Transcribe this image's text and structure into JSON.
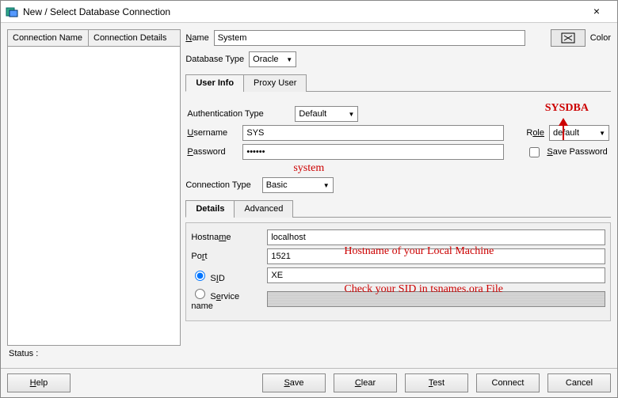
{
  "window": {
    "title": "New / Select Database Connection",
    "close_glyph": "×"
  },
  "left": {
    "col_name": "Connection Name",
    "col_details": "Connection Details",
    "status_label": "Status :"
  },
  "form": {
    "name_label_pre": "N",
    "name_label_post": "ame",
    "name_value": "System",
    "color_label": "Color",
    "dbtype_label": "Database Type",
    "dbtype_value": "Oracle",
    "tab_userinfo": "User Info",
    "tab_proxy": "Proxy User",
    "authtype_label": "Authentication Type",
    "authtype_value": "Default",
    "username_label_pre": "U",
    "username_label_post": "sername",
    "username_value": "SYS",
    "password_label_pre": "P",
    "password_label_post": "assword",
    "password_value": "••••••",
    "role_label_pre": "R",
    "role_label_post": "ole",
    "role_value": "default",
    "savepass_label_pre": "S",
    "savepass_label_post": "ave Password",
    "conntype_label": "Connection Type",
    "conntype_value": "Basic",
    "tab_details": "Details",
    "tab_advanced": "Advanced",
    "hostname_label_pre": "Hostna",
    "hostname_label_u": "m",
    "hostname_label_post": "e",
    "hostname_value": "localhost",
    "port_label_pre": "Po",
    "port_label_u": "r",
    "port_label_post": "t",
    "port_value": "1521",
    "sid_label_pre": "S",
    "sid_label_u": "I",
    "sid_label_post": "D",
    "sid_value": "XE",
    "service_label_pre": "S",
    "service_label_u": "e",
    "service_label_post": "rvice name"
  },
  "annotations": {
    "sysdba": "SYSDBA",
    "system": "system",
    "hostname_hint": "Hostname of your Local Machine",
    "sid_hint": "Check your SID in tsnames.ora File"
  },
  "buttons": {
    "help_pre": "H",
    "help_post": "elp",
    "save_pre": "S",
    "save_post": "ave",
    "clear_pre": "C",
    "clear_post": "lear",
    "test_pre": "T",
    "test_post": "est",
    "connect": "Connect",
    "cancel": "Cancel"
  }
}
